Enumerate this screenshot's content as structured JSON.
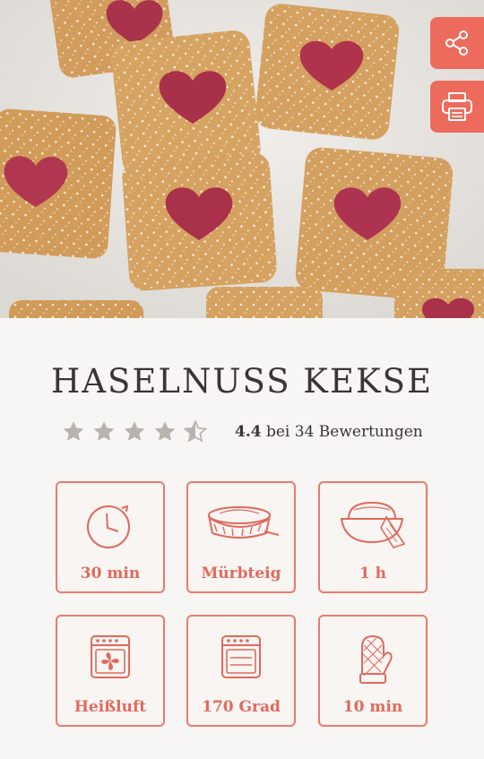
{
  "recipe": {
    "title": "HASELNUSS KEKSE",
    "rating_value": "4.4",
    "rating_suffix": "bei 34 Bewertungen",
    "rating": 4.4,
    "stars_max": 5
  },
  "actions": {
    "share_icon": "share-icon",
    "print_icon": "printer-icon"
  },
  "colors": {
    "accent": "#ec6b5c",
    "star": "#b9b3ae",
    "text": "#3a3432"
  },
  "info_tiles": [
    {
      "label": "30 min",
      "icon": "timer-icon"
    },
    {
      "label": "Mürbteig",
      "icon": "pie-dough-icon"
    },
    {
      "label": "1 h",
      "icon": "dough-bowl-icon"
    },
    {
      "label": "Heißluft",
      "icon": "oven-fan-icon"
    },
    {
      "label": "170 Grad",
      "icon": "oven-temperature-icon"
    },
    {
      "label": "10 min",
      "icon": "oven-mitt-icon"
    }
  ]
}
